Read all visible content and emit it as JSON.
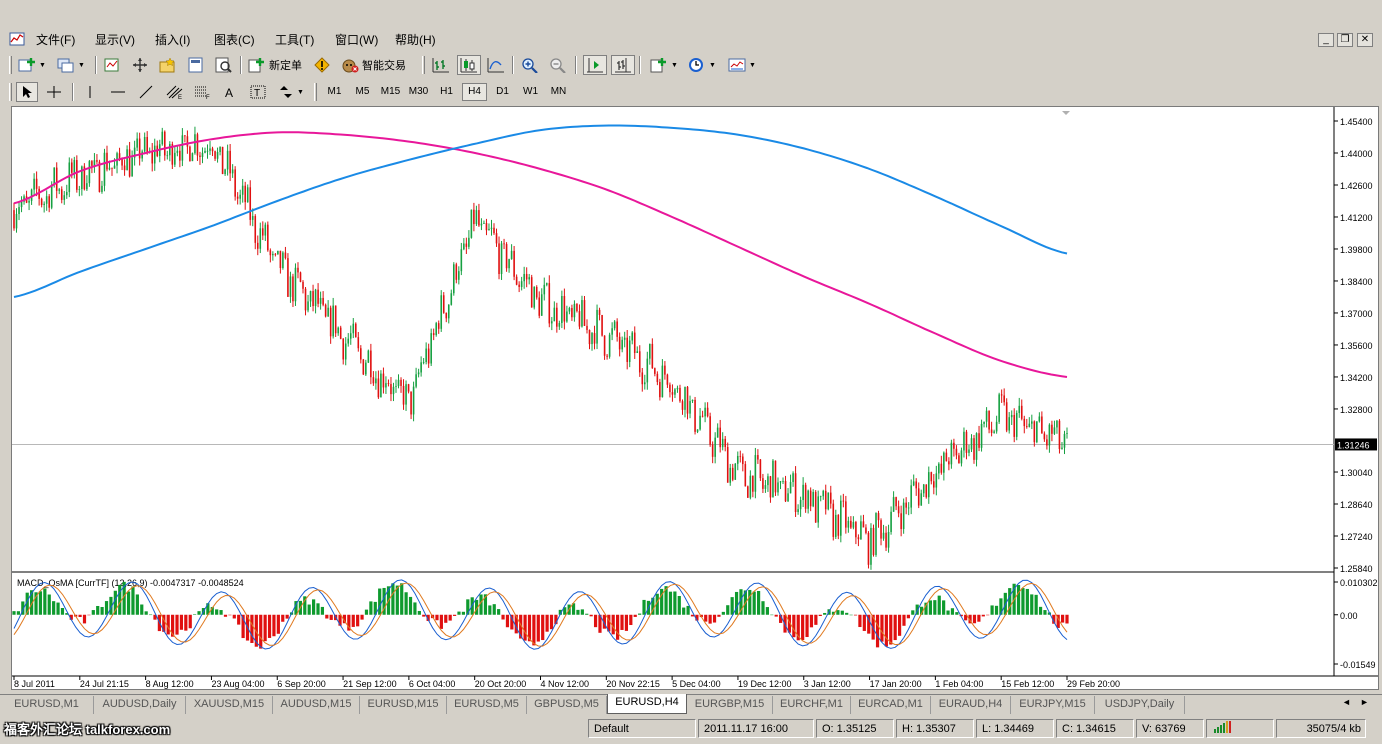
{
  "menu": [
    "文件(F)",
    "显示(V)",
    "插入(I)",
    "图表(C)",
    "工具(T)",
    "窗口(W)",
    "帮助(H)"
  ],
  "toolbar": {
    "new_order": "新定单",
    "expert": "智能交易"
  },
  "periods": [
    "M1",
    "M5",
    "M15",
    "M30",
    "H1",
    "H4",
    "D1",
    "W1",
    "MN"
  ],
  "active_period": "H4",
  "indicator_label": "MACD_OsMA [CurrTF] (12,26,9) -0.0047317 -0.0048524",
  "price_axis": [
    "1.45400",
    "1.44000",
    "1.42600",
    "1.41200",
    "1.39800",
    "1.38400",
    "1.37000",
    "1.35600",
    "1.34200",
    "1.32800",
    "1.31246",
    "1.30040",
    "1.28640",
    "1.27240",
    "1.25840"
  ],
  "current_price": "1.31246",
  "indicator_axis": [
    "0.010302",
    "0.00",
    "-0.01549"
  ],
  "time_axis": [
    "8 Jul 2011",
    "24 Jul 21:15",
    "8 Aug 12:00",
    "23 Aug 04:00",
    "6 Sep 20:00",
    "21 Sep 12:00",
    "6 Oct 04:00",
    "20 Oct 20:00",
    "4 Nov 12:00",
    "20 Nov 22:15",
    "5 Dec 04:00",
    "19 Dec 12:00",
    "3 Jan 12:00",
    "17 Jan 20:00",
    "1 Feb 04:00",
    "15 Feb 12:00",
    "29 Feb 20:00"
  ],
  "tabs": [
    "EURUSD,M1",
    "AUDUSD,Daily",
    "XAUUSD,M15",
    "AUDUSD,M15",
    "EURUSD,M15",
    "EURUSD,M5",
    "GBPUSD,M5",
    "EURUSD,H4",
    "EURGBP,M15",
    "EURCHF,M1",
    "EURCAD,M1",
    "EURAUD,H4",
    "EURJPY,M15",
    "USDJPY,Daily"
  ],
  "active_tab": "EURUSD,H4",
  "status": {
    "profile": "Default",
    "datetime": "2011.11.17 16:00",
    "open": "O: 1.35125",
    "high": "H: 1.35307",
    "low": "L: 1.34469",
    "close": "C: 1.34615",
    "volume": "V: 63769",
    "traffic": "35075/4 kb"
  },
  "watermark": "福客外汇论坛 talkforex.com",
  "chart_data": {
    "type": "candlestick",
    "symbol": "EURUSD",
    "timeframe": "H4",
    "x": [
      "8 Jul 2011",
      "24 Jul 21:15",
      "8 Aug 12:00",
      "23 Aug 04:00",
      "6 Sep 20:00",
      "21 Sep 12:00",
      "6 Oct 04:00",
      "20 Oct 20:00",
      "4 Nov 12:00",
      "20 Nov 22:15",
      "5 Dec 04:00",
      "19 Dec 12:00",
      "3 Jan 12:00",
      "17 Jan 20:00",
      "1 Feb 04:00",
      "15 Feb 12:00",
      "29 Feb 20:00"
    ],
    "close_approx": [
      1.415,
      1.43,
      1.44,
      1.445,
      1.39,
      1.36,
      1.33,
      1.41,
      1.375,
      1.36,
      1.34,
      1.3,
      1.29,
      1.27,
      1.3,
      1.325,
      1.31246
    ],
    "ylim": [
      1.2584,
      1.454
    ],
    "moving_average_magenta_approx": [
      1.418,
      1.432,
      1.44,
      1.446,
      1.449,
      1.448,
      1.445,
      1.44,
      1.433,
      1.424,
      1.412,
      1.399,
      1.386,
      1.374,
      1.361,
      1.349,
      1.342
    ],
    "moving_average_blue_approx": [
      1.377,
      1.388,
      1.398,
      1.408,
      1.419,
      1.429,
      1.437,
      1.444,
      1.45,
      1.452,
      1.451,
      1.448,
      1.442,
      1.433,
      1.421,
      1.408,
      1.396
    ],
    "indicator": {
      "name": "MACD_OsMA",
      "params": "(12,26,9)",
      "ylim": [
        -0.01549,
        0.010302
      ]
    }
  },
  "colors": {
    "bull": "#16a041",
    "bear": "#e01010",
    "ma_magenta": "#e8179a",
    "ma_blue": "#1a8ae6",
    "macd_line": "#1a5fd0",
    "signal_line": "#e07a20",
    "hist_pos": "#0e9a2e",
    "hist_neg": "#e01010"
  }
}
